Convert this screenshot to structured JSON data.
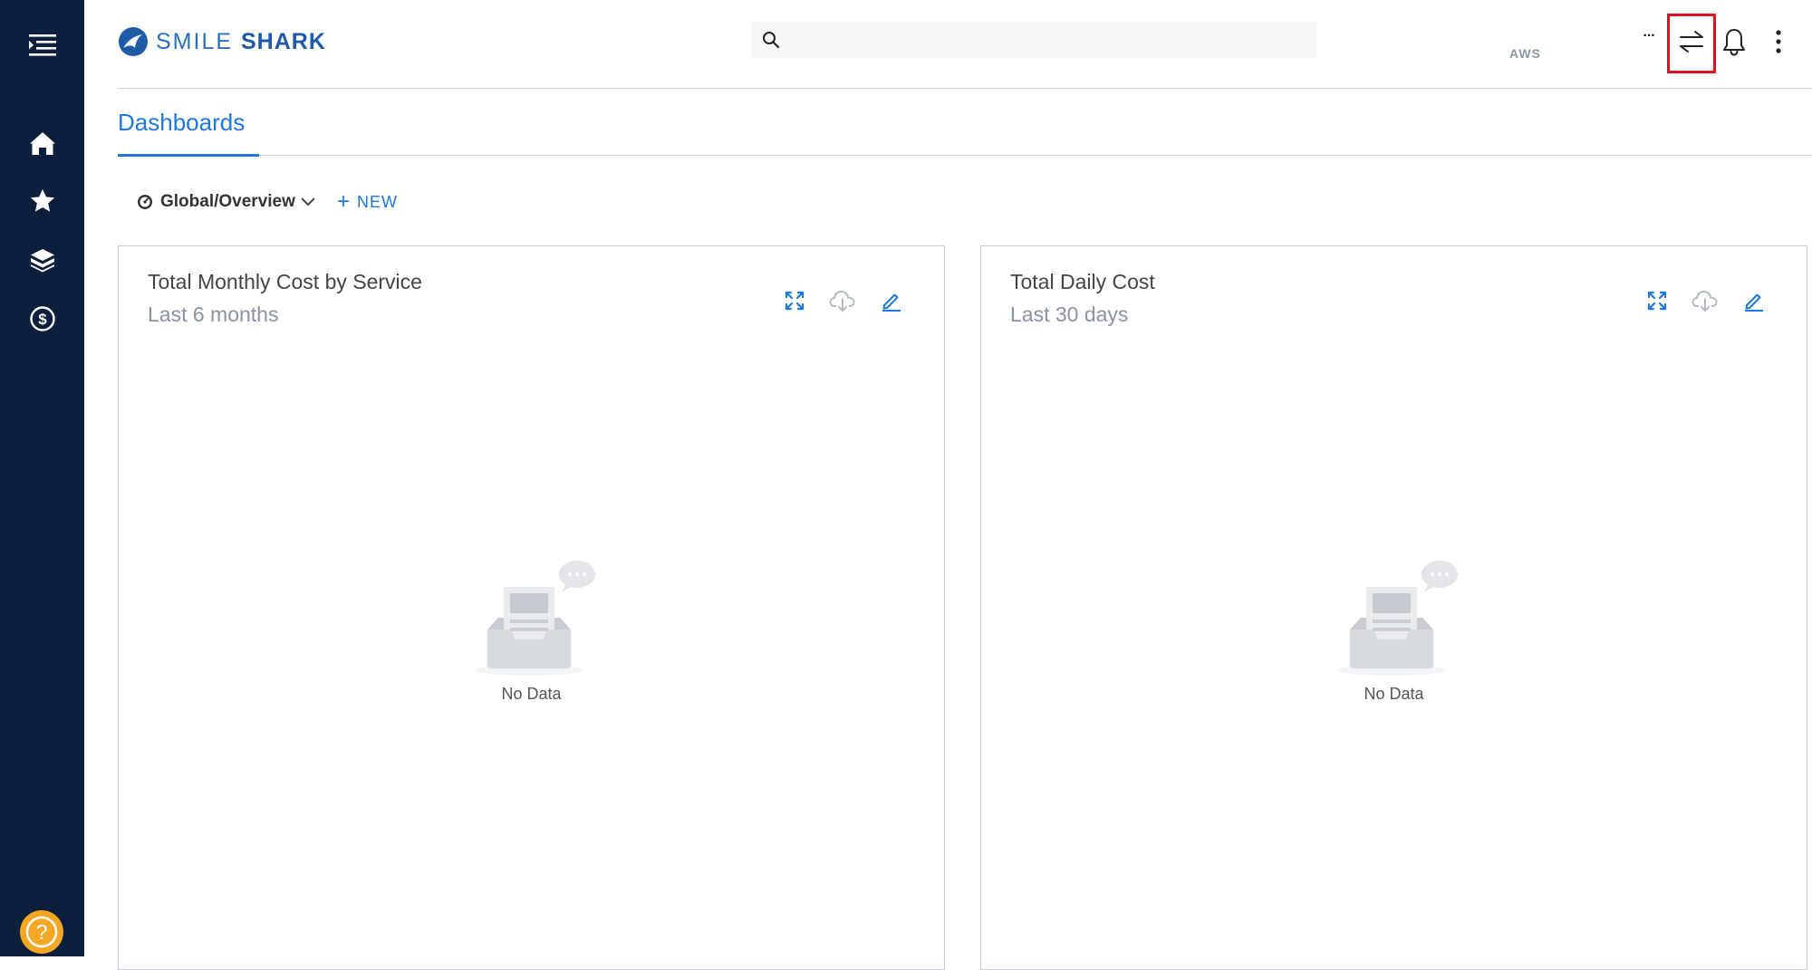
{
  "brand": {
    "name_light": "SMILE",
    "name_bold": "SHARK",
    "color": "#1e5aa6"
  },
  "sidebar": {
    "bg": "#0c1f3d",
    "items": [
      {
        "icon": "menu-icon"
      },
      {
        "icon": "home-icon"
      },
      {
        "icon": "star-icon"
      },
      {
        "icon": "cube-icon"
      },
      {
        "icon": "dollar-icon"
      }
    ],
    "help_icon": "help-icon"
  },
  "header": {
    "search": {
      "placeholder": "",
      "value": ""
    },
    "account": "AWS",
    "more_dots": "···"
  },
  "tabs": [
    {
      "label": "Dashboards",
      "active": true
    }
  ],
  "toolbar": {
    "dashboard_selector": "Global/Overview",
    "new_label": "NEW"
  },
  "cards": [
    {
      "title": "Total Monthly Cost by Service",
      "subtitle": "Last 6 months",
      "empty_label": "No Data"
    },
    {
      "title": "Total Daily Cost",
      "subtitle": "Last 30 days",
      "empty_label": "No Data"
    }
  ],
  "colors": {
    "accent": "#1f77e0",
    "highlight": "#e00e1a",
    "help": "#f5a623"
  }
}
